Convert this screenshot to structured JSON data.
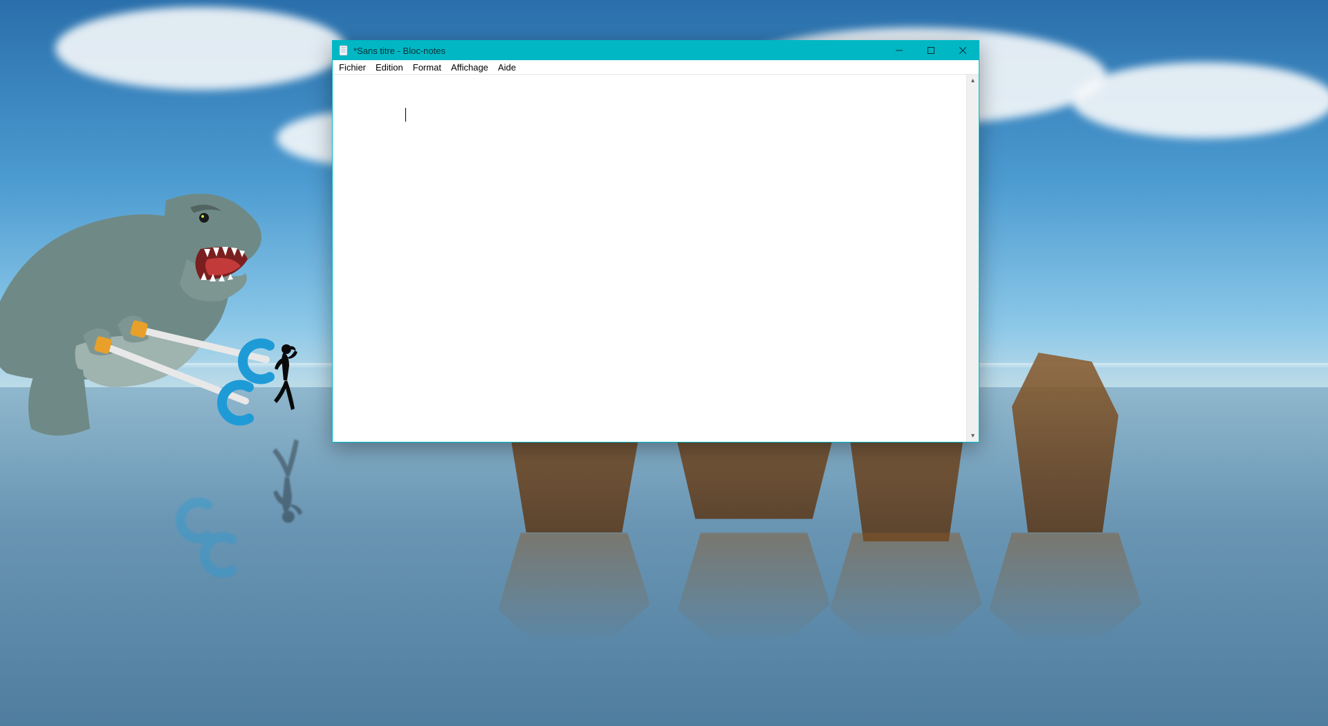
{
  "window": {
    "title": "*Sans titre - Bloc-notes"
  },
  "menu": {
    "items": [
      "Fichier",
      "Edition",
      "Format",
      "Affichage",
      "Aide"
    ]
  },
  "editor": {
    "content": ""
  }
}
